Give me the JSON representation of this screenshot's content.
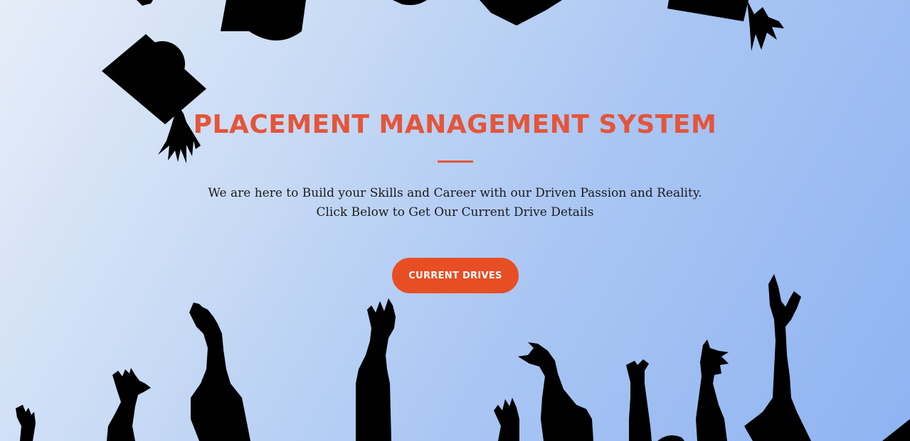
{
  "hero": {
    "title": "PLACEMENT MANAGEMENT SYSTEM",
    "tagline_line1": "We are here to Build your Skills and Career with our Driven Passion and Reality.",
    "tagline_line2": "Click Below to Get Our Current Drive Details",
    "cta_label": "CURRENT DRIVES"
  },
  "colors": {
    "accent": "#e4553a",
    "button": "#e84e24",
    "silhouette": "#000000",
    "background_start": "#e6edf8",
    "background_end": "#8fb3f2"
  },
  "icons": {
    "caps": "graduation-cap-icon",
    "hands": "raised-hand-icon"
  }
}
